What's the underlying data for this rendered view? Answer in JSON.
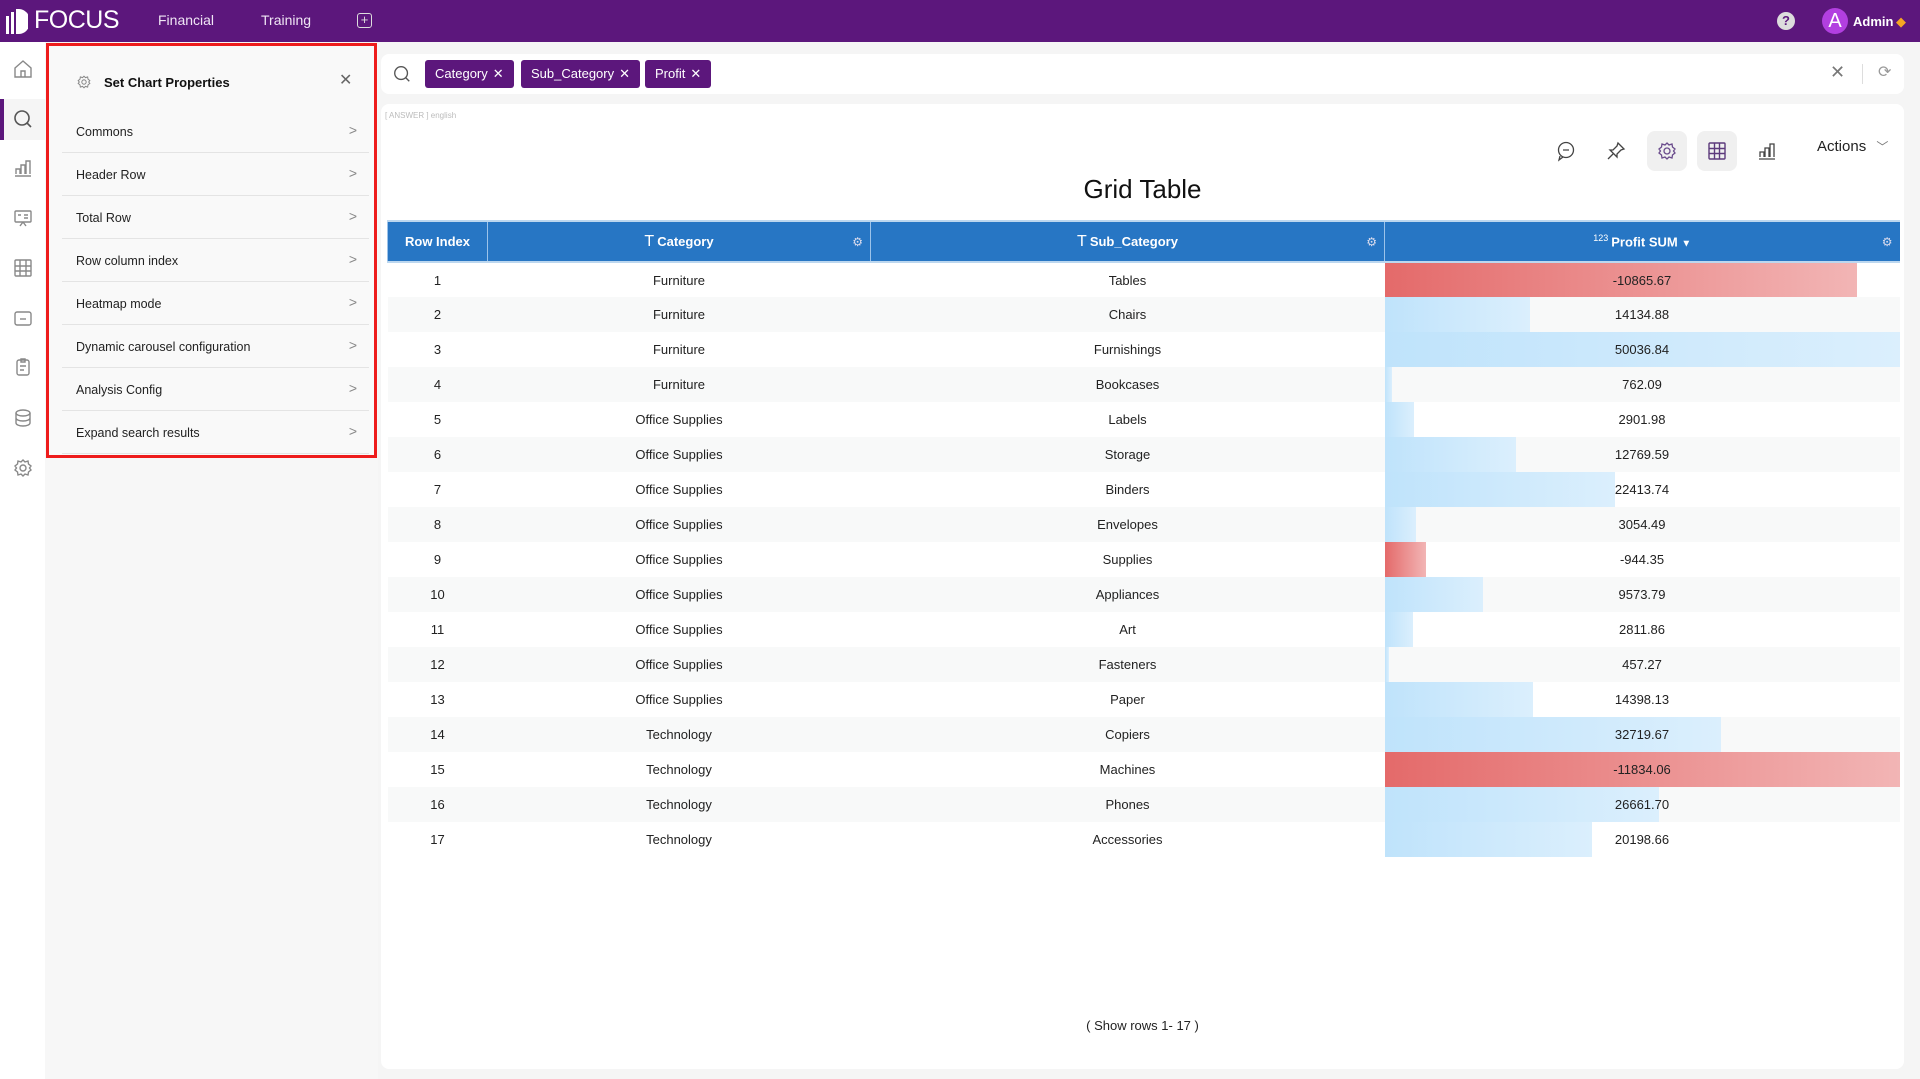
{
  "app": {
    "logo": "FOCUS",
    "nav": [
      "Financial",
      "Training"
    ],
    "user": "Admin",
    "avatar_letter": "A",
    "accent": "#5c177c"
  },
  "rail": {
    "icons": [
      "home-icon",
      "search-icon",
      "chart-icon",
      "presentation-icon",
      "table-icon",
      "folder-icon",
      "clipboard-icon",
      "database-icon",
      "settings-icon"
    ],
    "active": "search-icon"
  },
  "panel": {
    "title": "Set Chart Properties",
    "items": [
      "Commons",
      "Header Row",
      "Total Row",
      "Row column index",
      "Heatmap mode",
      "Dynamic carousel configuration",
      "Analysis Config",
      "Expand search results"
    ]
  },
  "search": {
    "chips": [
      "Category",
      "Sub_Category",
      "Profit"
    ],
    "hint": "[ ANSWER ] english"
  },
  "toolbar": {
    "actions_label": "Actions",
    "icons": [
      "comment-icon",
      "pin-icon",
      "settings-icon",
      "table-icon",
      "bar-chart-icon"
    ],
    "selected": [
      "settings-icon",
      "table-icon"
    ]
  },
  "chart_data": {
    "type": "table",
    "title": "Grid Table",
    "columns": [
      "Row Index",
      "Category",
      "Sub_Category",
      "Profit SUM"
    ],
    "rows": [
      [
        1,
        "Furniture",
        "Tables",
        "-10865.67"
      ],
      [
        2,
        "Furniture",
        "Chairs",
        "14134.88"
      ],
      [
        3,
        "Furniture",
        "Furnishings",
        "50036.84"
      ],
      [
        4,
        "Furniture",
        "Bookcases",
        "762.09"
      ],
      [
        5,
        "Office Supplies",
        "Labels",
        "2901.98"
      ],
      [
        6,
        "Office Supplies",
        "Storage",
        "12769.59"
      ],
      [
        7,
        "Office Supplies",
        "Binders",
        "22413.74"
      ],
      [
        8,
        "Office Supplies",
        "Envelopes",
        "3054.49"
      ],
      [
        9,
        "Office Supplies",
        "Supplies",
        "-944.35"
      ],
      [
        10,
        "Office Supplies",
        "Appliances",
        "9573.79"
      ],
      [
        11,
        "Office Supplies",
        "Art",
        "2811.86"
      ],
      [
        12,
        "Office Supplies",
        "Fasteners",
        "457.27"
      ],
      [
        13,
        "Office Supplies",
        "Paper",
        "14398.13"
      ],
      [
        14,
        "Technology",
        "Copiers",
        "32719.67"
      ],
      [
        15,
        "Technology",
        "Machines",
        "-11834.06"
      ],
      [
        16,
        "Technology",
        "Phones",
        "26661.70"
      ],
      [
        17,
        "Technology",
        "Accessories",
        "20198.66"
      ]
    ],
    "sort": "Profit SUM descending",
    "positive_bar_color": "#bfe3fb",
    "negative_bar_color": "#e46a6a",
    "header_color": "#2776c4"
  },
  "footer": "( Show rows 1- 17 )"
}
